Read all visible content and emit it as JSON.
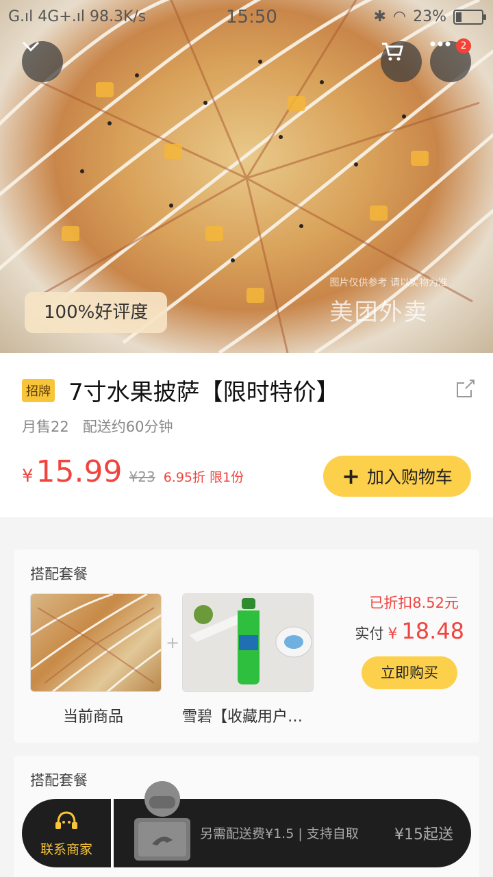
{
  "status_bar": {
    "signal": "G.ıl 4G+.ıl",
    "speed": "98.3K/s",
    "time": "15:50",
    "battery": "23%",
    "battery_level": 0.23
  },
  "hero": {
    "rating_badge": "100%好评度",
    "watermark_note": "图片仅供参考 请以实物为准",
    "watermark_brand": "美团外卖",
    "menu_badge_count": "2"
  },
  "product": {
    "tag": "招牌",
    "title": "7寸水果披萨【限时特价】",
    "monthly_sales": "月售22",
    "delivery_time": "配送约60分钟",
    "currency": "¥",
    "price": "15.99",
    "original_price": "¥23",
    "discount": "6.95折 限1份",
    "add_to_cart": "加入购物车"
  },
  "combos": [
    {
      "title": "搭配套餐",
      "item1_caption": "当前商品",
      "item2_caption": "雪碧【收藏用户…",
      "saved": "已折扣8.52元",
      "actual_label": "实付",
      "actual_currency": "¥",
      "actual_value": "18.48",
      "buy_label": "立即购买"
    },
    {
      "title": "搭配套餐"
    }
  ],
  "bottom_bar": {
    "contact_label": "联系商家",
    "delivery_fee": "另需配送费¥1.5 | 支持自取",
    "min_order": "¥15起送"
  },
  "colors": {
    "accent_yellow": "#fdd04c",
    "price_red": "#f0443f"
  }
}
